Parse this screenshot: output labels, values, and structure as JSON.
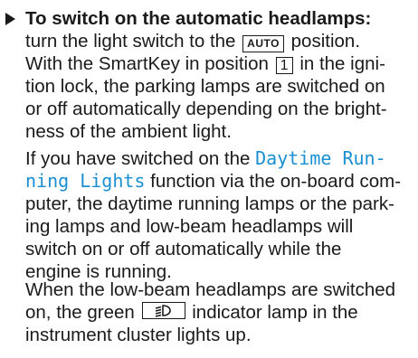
{
  "step": {
    "heading": "To switch on the automatic headlamps:",
    "para1": {
      "l1_a": "turn the light switch to the",
      "auto_label": "AUTO",
      "l1_b": "position.",
      "l2_a": "With the SmartKey in position",
      "position_number": "1",
      "l2_b": "in the igni-",
      "l3": "tion lock, the parking lamps are switched on",
      "l4": "or off automatically depending on the bright-",
      "l5": "ness of the ambient light."
    },
    "para2": {
      "l1_a": "If you have switched on the",
      "fn_part1": "Daytime Run-",
      "fn_part2": "ning Lights",
      "l2_b": "function via the on-board com-",
      "l3": "puter, the daytime running lamps or the park-",
      "l4": "ing lamps and low-beam headlamps will",
      "l5": "switch on or off automatically while the",
      "l6": "engine is running."
    },
    "para3": {
      "l1": "When the low-beam headlamps are switched",
      "l2_a": "on, the green",
      "l2_b": "indicator lamp in the",
      "l3": "instrument cluster lights up."
    }
  },
  "colors": {
    "text": "#1a1a1a",
    "function_name": "#1a8fd1"
  },
  "icons": {
    "bullet": "right-triangle-arrow-icon",
    "indicator": "low-beam-headlamp-icon"
  }
}
